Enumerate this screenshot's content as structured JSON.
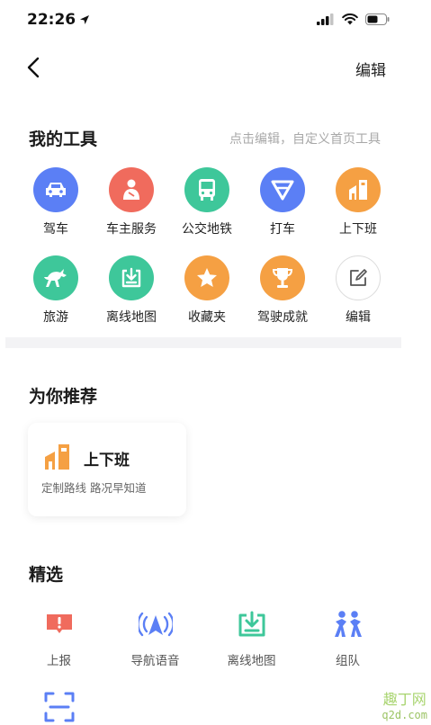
{
  "status_bar": {
    "time": "22:26"
  },
  "nav": {
    "edit_label": "编辑"
  },
  "my_tools": {
    "title": "我的工具",
    "hint": "点击编辑，自定义首页工具",
    "items": [
      {
        "label": "驾车",
        "icon": "car-icon",
        "color": "#5b7ff5"
      },
      {
        "label": "车主服务",
        "icon": "car-owner-service-icon",
        "color": "#f06b5d"
      },
      {
        "label": "公交地铁",
        "icon": "bus-icon",
        "color": "#3ec79a"
      },
      {
        "label": "打车",
        "icon": "taxi-icon",
        "color": "#5b7ff5"
      },
      {
        "label": "上下班",
        "icon": "commute-icon",
        "color": "#f5a043"
      },
      {
        "label": "旅游",
        "icon": "travel-horse-icon",
        "color": "#3ec79a"
      },
      {
        "label": "离线地图",
        "icon": "offline-map-icon",
        "color": "#3ec79a"
      },
      {
        "label": "收藏夹",
        "icon": "star-icon",
        "color": "#f5a043"
      },
      {
        "label": "驾驶成就",
        "icon": "trophy-icon",
        "color": "#f5a043"
      },
      {
        "label": "编辑",
        "icon": "edit-icon",
        "color": "#ffffff"
      }
    ]
  },
  "recommend": {
    "title": "为你推荐",
    "card": {
      "title": "上下班",
      "subtitle": "定制路线 路况早知道",
      "icon": "commute-icon",
      "color": "#f5a043"
    }
  },
  "featured": {
    "title": "精选",
    "items": [
      {
        "label": "上报",
        "icon": "report-icon",
        "color": "#f06b5d"
      },
      {
        "label": "导航语音",
        "icon": "navigation-voice-icon",
        "color": "#5b7ff5"
      },
      {
        "label": "离线地图",
        "icon": "offline-map-icon",
        "color": "#3ec79a"
      },
      {
        "label": "组队",
        "icon": "team-icon",
        "color": "#5b7ff5"
      }
    ]
  },
  "watermark": {
    "line1": "趣丁网",
    "line2": "q2d.com"
  }
}
